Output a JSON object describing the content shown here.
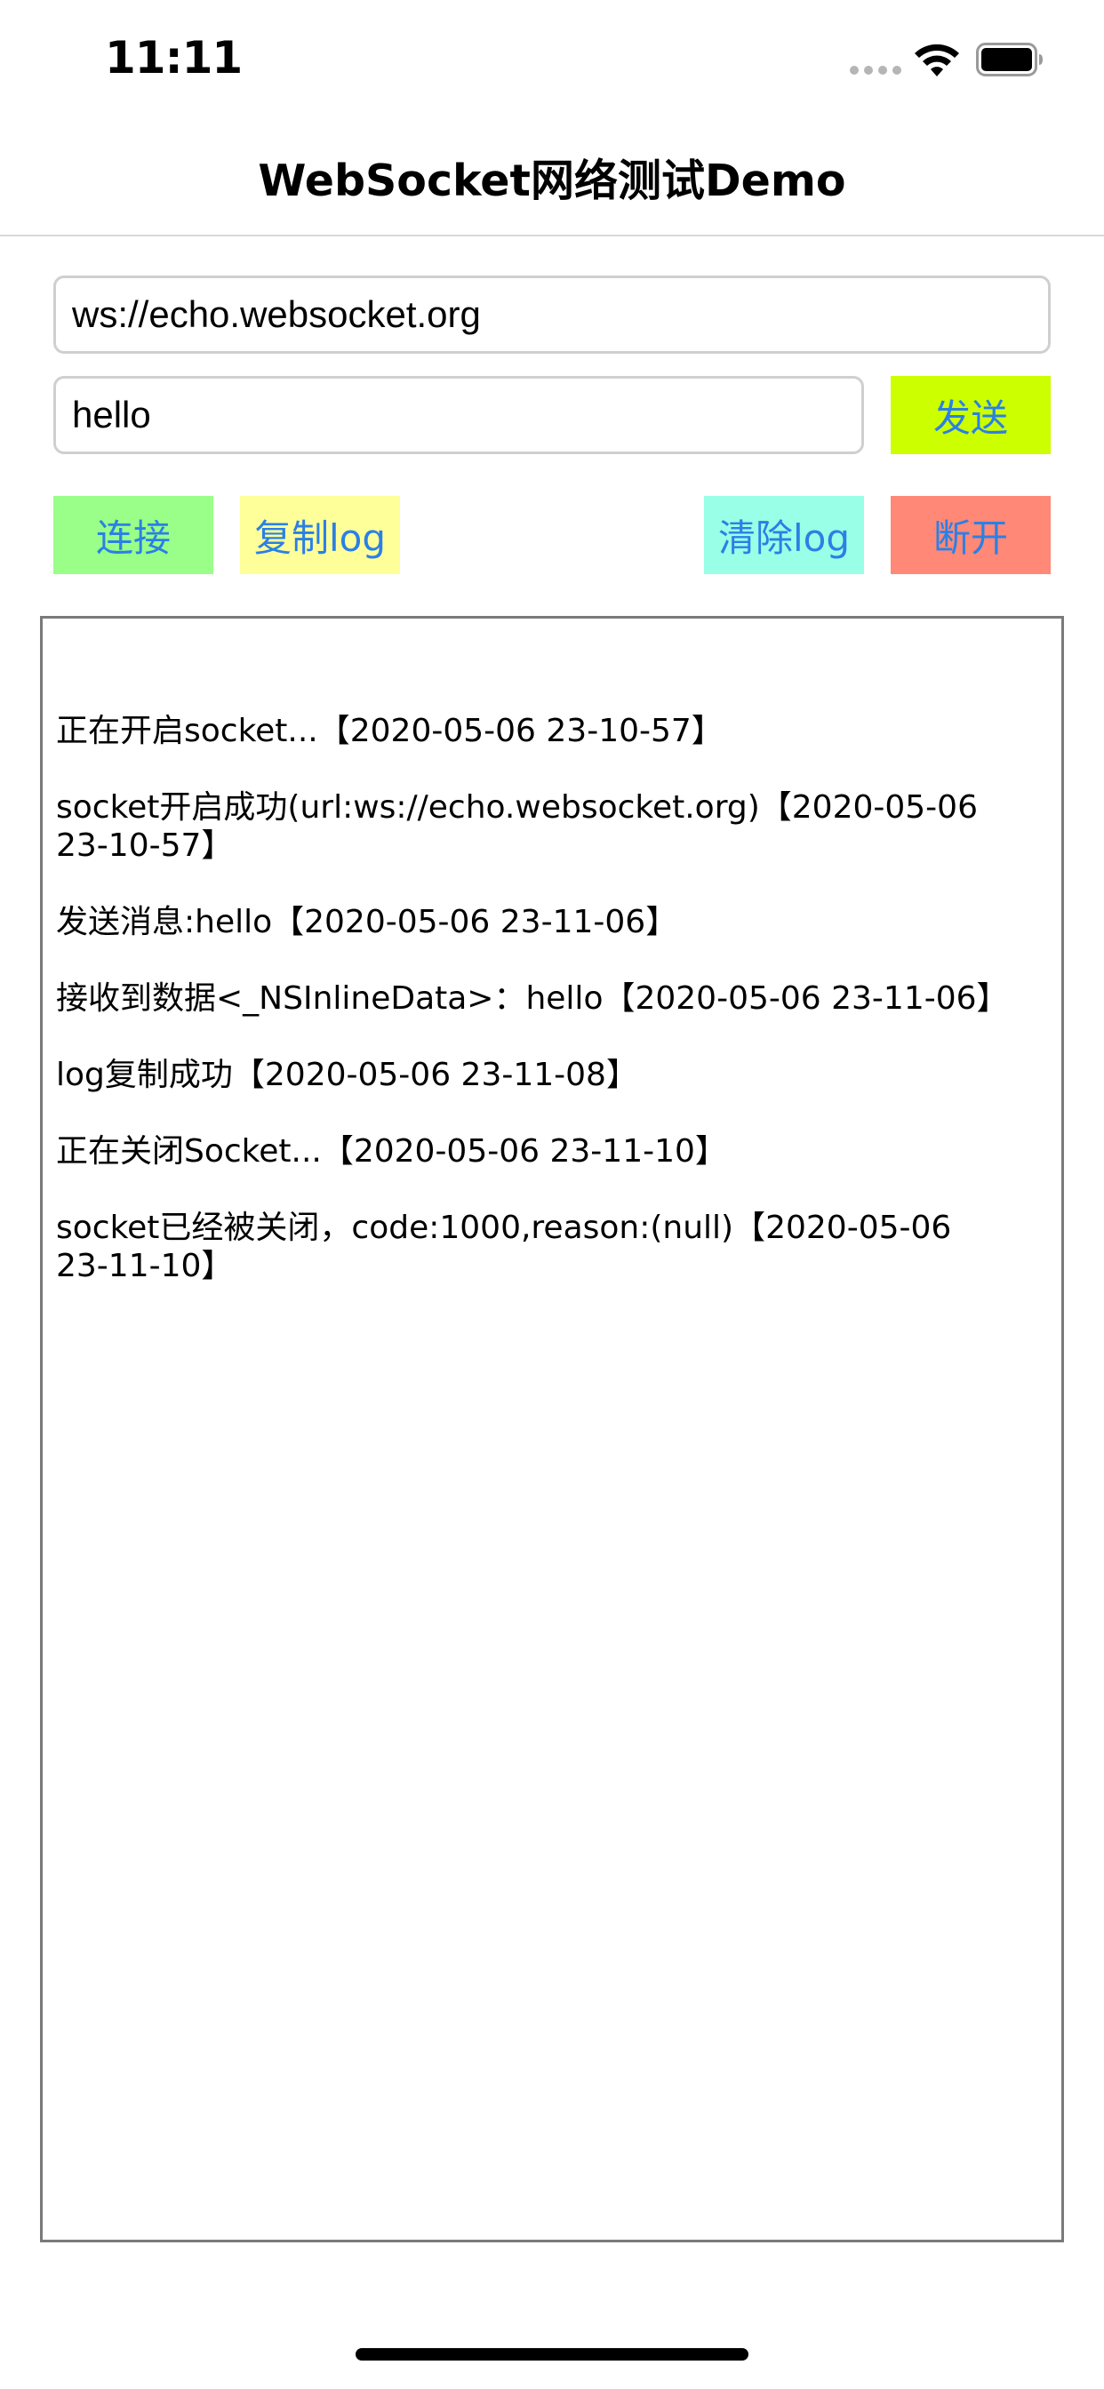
{
  "status_bar": {
    "time": "11:11",
    "signal_icon": "signal-dots-icon",
    "wifi_icon": "wifi-icon",
    "battery_icon": "battery-icon"
  },
  "nav": {
    "title": "WebSocket网络测试Demo"
  },
  "form": {
    "url_value": "ws://echo.websocket.org",
    "message_value": "hello"
  },
  "buttons": {
    "send": "发送",
    "connect": "连接",
    "copy_log": "复制log",
    "clear_log": "清除log",
    "disconnect": "断开"
  },
  "colors": {
    "send_bg": "#ccff00",
    "connect_bg": "#99ff88",
    "copy_bg": "#ffff99",
    "clear_bg": "#99ffe6",
    "disconnect_bg": "#ff8877",
    "button_text": "#2a80e6"
  },
  "log": {
    "lines": [
      "正在开启socket...【2020-05-06 23-10-57】",
      "socket开启成功(url:ws://echo.websocket.org)【2020-05-06\n23-10-57】",
      "发送消息:hello【2020-05-06 23-11-06】",
      "接收到数据<_NSInlineData>：hello【2020-05-06 23-11-06】",
      "log复制成功【2020-05-06 23-11-08】",
      "正在关闭Socket...【2020-05-06 23-11-10】",
      "socket已经被关闭，code:1000,reason:(null)【2020-05-06\n23-11-10】"
    ]
  }
}
